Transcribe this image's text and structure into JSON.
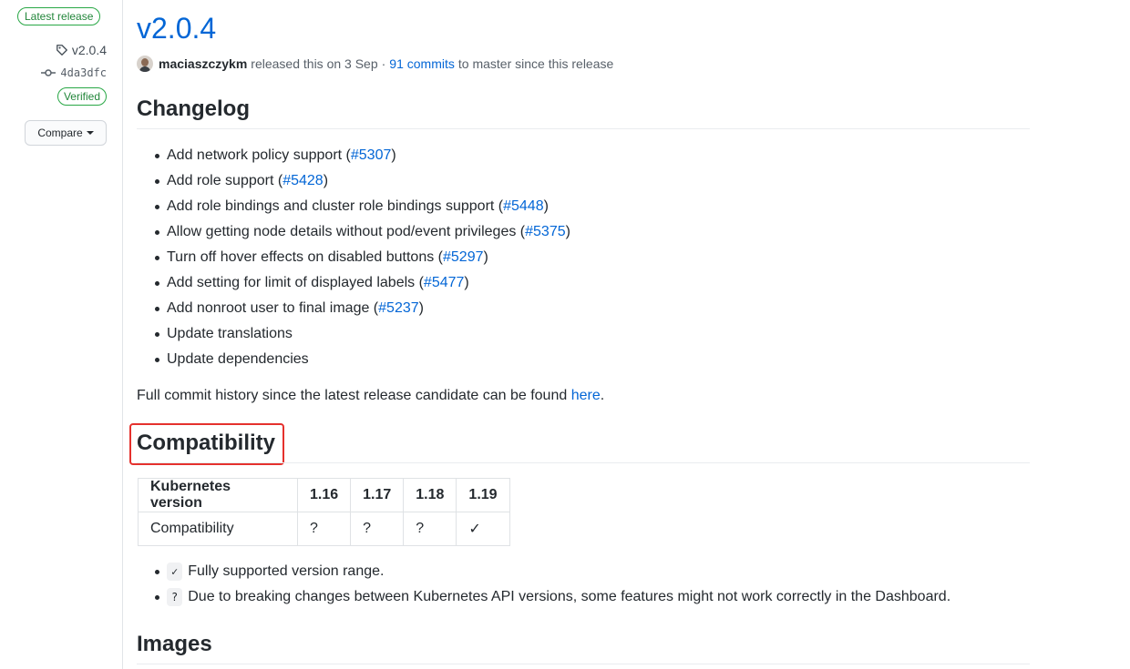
{
  "sidebar": {
    "latest_badge": "Latest release",
    "tag": "v2.0.4",
    "commit": "4da3dfc",
    "verified": "Verified",
    "compare_label": "Compare"
  },
  "release": {
    "title": "v2.0.4",
    "author": "maciaszczykm",
    "released_text": "released this on 3 Sep",
    "separator": "·",
    "commits_link": "91 commits",
    "commits_suffix": "to master since this release"
  },
  "changelog": {
    "heading": "Changelog",
    "items": [
      {
        "text": "Add network policy support (",
        "link": "#5307",
        "suffix": ")"
      },
      {
        "text": "Add role support (",
        "link": "#5428",
        "suffix": ")"
      },
      {
        "text": "Add role bindings and cluster role bindings support (",
        "link": "#5448",
        "suffix": ")"
      },
      {
        "text": "Allow getting node details without pod/event privileges (",
        "link": "#5375",
        "suffix": ")"
      },
      {
        "text": "Turn off hover effects on disabled buttons (",
        "link": "#5297",
        "suffix": ")"
      },
      {
        "text": "Add setting for limit of displayed labels (",
        "link": "#5477",
        "suffix": ")"
      },
      {
        "text": "Add nonroot user to final image (",
        "link": "#5237",
        "suffix": ")"
      },
      {
        "text": "Update translations",
        "link": "",
        "suffix": ""
      },
      {
        "text": "Update dependencies",
        "link": "",
        "suffix": ""
      }
    ],
    "history_text": "Full commit history since the latest release candidate can be found",
    "history_link": "here",
    "history_end": "."
  },
  "compatibility": {
    "heading": "Compatibility",
    "table": {
      "headers": [
        "Kubernetes version",
        "1.16",
        "1.17",
        "1.18",
        "1.19"
      ],
      "row": [
        "Compatibility",
        "?",
        "?",
        "?",
        "✓"
      ]
    },
    "notes": [
      {
        "chip": "✓",
        "text": "Fully supported version range."
      },
      {
        "chip": "?",
        "text": "Due to breaking changes between Kubernetes API versions, some features might not work correctly in the Dashboard."
      }
    ]
  },
  "images": {
    "heading": "Images"
  },
  "colors": {
    "link": "#0366d6",
    "verified_green": "#28a745",
    "highlight_red": "#e5312d"
  }
}
